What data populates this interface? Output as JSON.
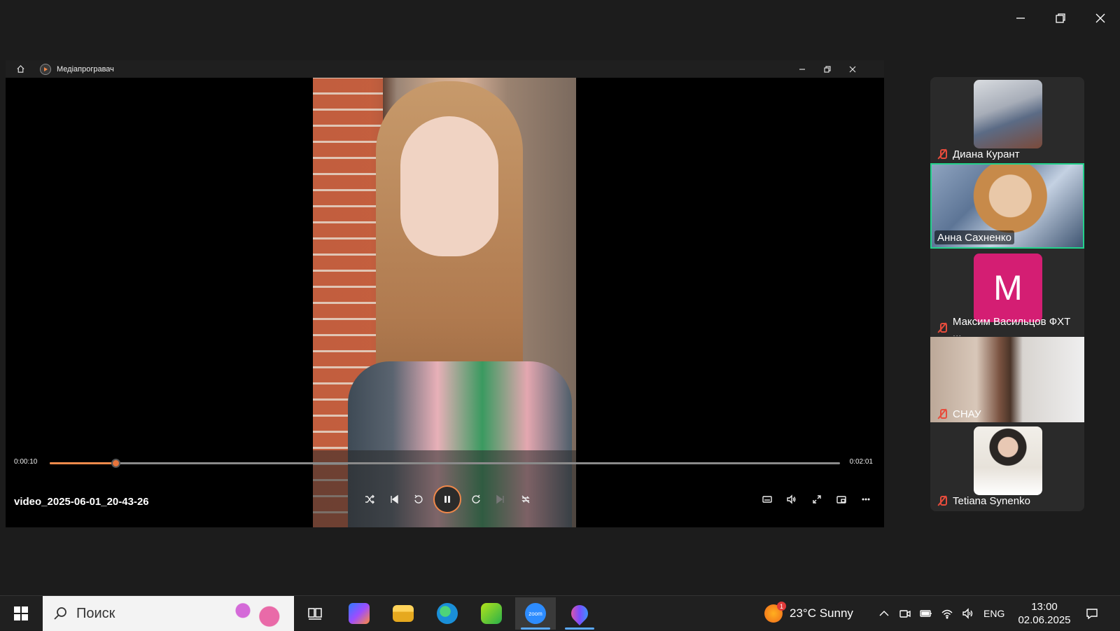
{
  "player": {
    "app_title": "Медіапрогравач",
    "file_name": "video_2025-06-01_20-43-26",
    "time_current": "0:00:10",
    "time_total": "0:02:01",
    "progress_fraction": 0.083
  },
  "participants": [
    {
      "name": "Диана Курант",
      "muted": true,
      "type": "video"
    },
    {
      "name": "Анна Сахненко",
      "muted": false,
      "type": "video",
      "active_speaker": true
    },
    {
      "name": "Максим Васильцов ФХТ ...",
      "muted": true,
      "type": "avatar",
      "avatar_letter": "M",
      "avatar_color": "#d41e73"
    },
    {
      "name": "СНАУ",
      "muted": true,
      "type": "video"
    },
    {
      "name": "Tetiana Synenko",
      "muted": true,
      "type": "video"
    }
  ],
  "taskbar": {
    "search_placeholder": "Поиск",
    "weather": "23°C  Sunny",
    "weather_badge": "1",
    "language": "ENG",
    "time": "13:00",
    "date": "02.06.2025",
    "apps": [
      "task-view",
      "copilot",
      "file-explorer",
      "edge",
      "xbox",
      "zoom",
      "paint"
    ]
  },
  "colors": {
    "accent_orange": "#f0884a",
    "active_speaker_border": "#23d18b",
    "muted_red": "#e74c3c",
    "taskbar_indicator": "#5aa9ff"
  }
}
